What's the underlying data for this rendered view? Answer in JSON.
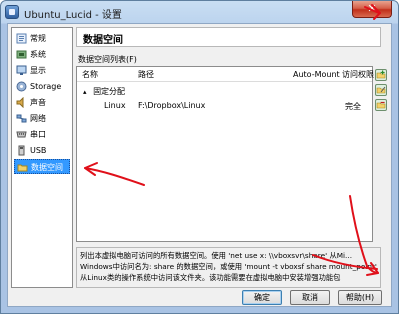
{
  "window": {
    "title": "Ubuntu_Lucid - 设置",
    "close_glyph": "✕"
  },
  "sidebar": {
    "items": [
      {
        "label": "常规",
        "icon": "general-icon",
        "selected": false
      },
      {
        "label": "系统",
        "icon": "system-icon",
        "selected": false
      },
      {
        "label": "显示",
        "icon": "display-icon",
        "selected": false
      },
      {
        "label": "Storage",
        "icon": "storage-icon",
        "selected": false
      },
      {
        "label": "声音",
        "icon": "audio-icon",
        "selected": false
      },
      {
        "label": "网络",
        "icon": "network-icon",
        "selected": false
      },
      {
        "label": "串口",
        "icon": "serial-port-icon",
        "selected": false
      },
      {
        "label": "USB",
        "icon": "usb-icon",
        "selected": false
      },
      {
        "label": "数据空间",
        "icon": "shared-folders-icon",
        "selected": true
      }
    ]
  },
  "main": {
    "title": "数据空间",
    "section_label": "数据空间列表(F)",
    "columns": {
      "name": "名称",
      "path": "路径",
      "automount": "Auto-Mount",
      "access": "访问权限"
    },
    "group": {
      "expander": "▴",
      "label": "固定分配"
    },
    "rows": [
      {
        "name": "Linux",
        "path": "F:\\Dropbox\\Linux",
        "automount": "",
        "access": "完全"
      }
    ],
    "description": [
      "列出本虚拟电脑可访问的所有数据空间。使用 'net use x: \\\\vboxsvr\\share' 从Mi...",
      "Windows中访问名为: share 的数据空间，或使用 'mount -t vboxsf share mount_point'",
      "从Linux类的操作系统中访问该文件夹。该功能需要在虚拟电脑中安装增强功能包"
    ]
  },
  "buttons": {
    "ok": "确定",
    "cancel": "取消",
    "help": "帮助(H)"
  },
  "colors": {
    "selection": "#3399ff",
    "annotation": "#e0101a",
    "title_bar": "#bcd4ee"
  }
}
